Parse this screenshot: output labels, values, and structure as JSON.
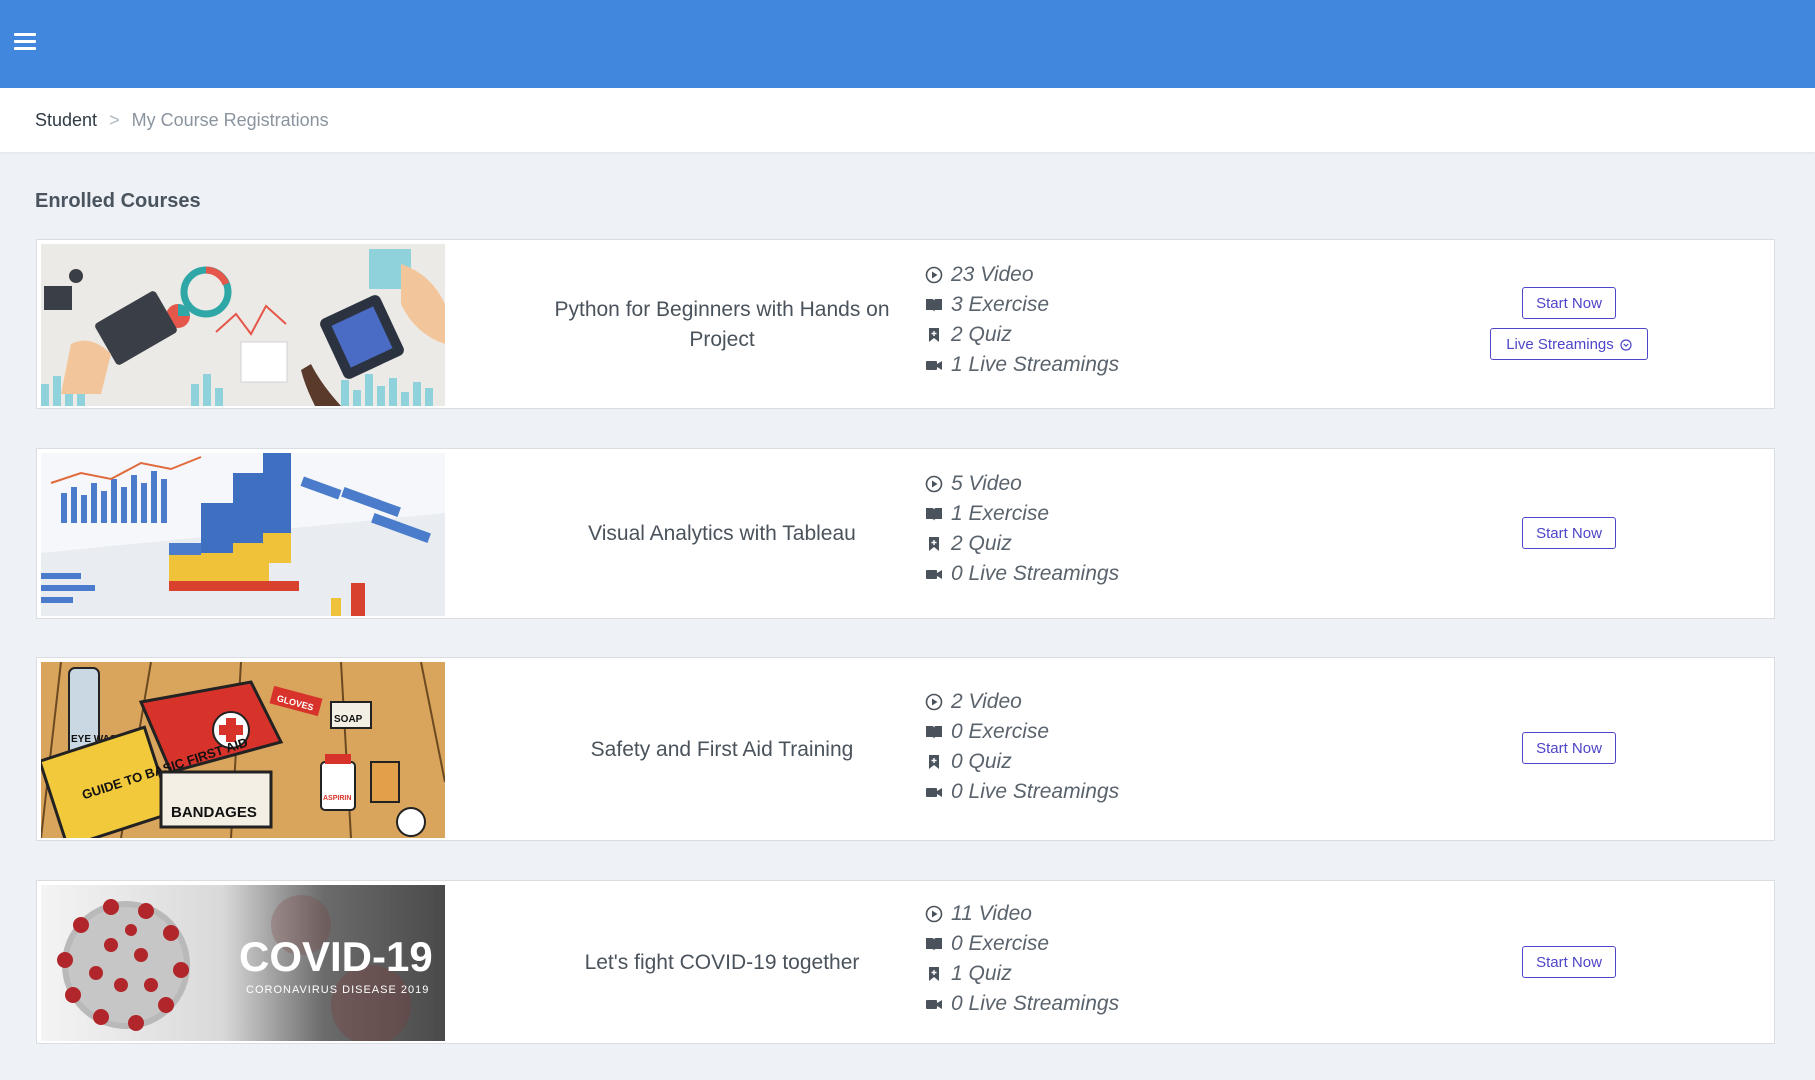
{
  "topbar": {
    "menu_icon": "hamburger-menu-icon",
    "color": "#4287de"
  },
  "breadcrumb": {
    "root": "Student",
    "separator": ">",
    "current": "My Course Registrations"
  },
  "section_title": "Enrolled Courses",
  "icons": {
    "video": "play-circle-icon",
    "exercise": "book-open-icon",
    "quiz": "bookmark-icon",
    "live": "video-camera-icon"
  },
  "courses": [
    {
      "title": "Python for Beginners with Hands on Project",
      "thumbnail": "workspace-analytics-illustration",
      "video": "23 Video",
      "exercise": "3 Exercise",
      "quiz": "2 Quiz",
      "live": "1 Live Streamings",
      "start_label": "Start Now",
      "live_label": "Live Streamings"
    },
    {
      "title": "Visual Analytics with Tableau",
      "thumbnail": "3d-bar-chart-photo",
      "video": "5 Video",
      "exercise": "1 Exercise",
      "quiz": "2 Quiz",
      "live": "0 Live Streamings",
      "start_label": "Start Now"
    },
    {
      "title": "Safety and First Aid Training",
      "thumbnail": "first-aid-kit-illustration",
      "thumb_text": {
        "guide": "GUIDE TO BASIC FIRST AID",
        "bandages": "BANDAGES",
        "eye_wash": "EYE WASH",
        "soap": "SOAP",
        "aspirin": "ASPIRIN",
        "gloves": "GLOVES"
      },
      "video": "2 Video",
      "exercise": "0 Exercise",
      "quiz": "0 Quiz",
      "live": "0 Live Streamings",
      "start_label": "Start Now"
    },
    {
      "title": "Let's fight COVID-19 together",
      "thumbnail": "covid-virus-banner",
      "thumb_text": {
        "headline": "COVID-19",
        "sub": "CORONAVIRUS DISEASE 2019"
      },
      "video": "11 Video",
      "exercise": "0 Exercise",
      "quiz": "1 Quiz",
      "live": "0 Live Streamings",
      "start_label": "Start Now"
    }
  ],
  "accent_color": "#4e45c9"
}
